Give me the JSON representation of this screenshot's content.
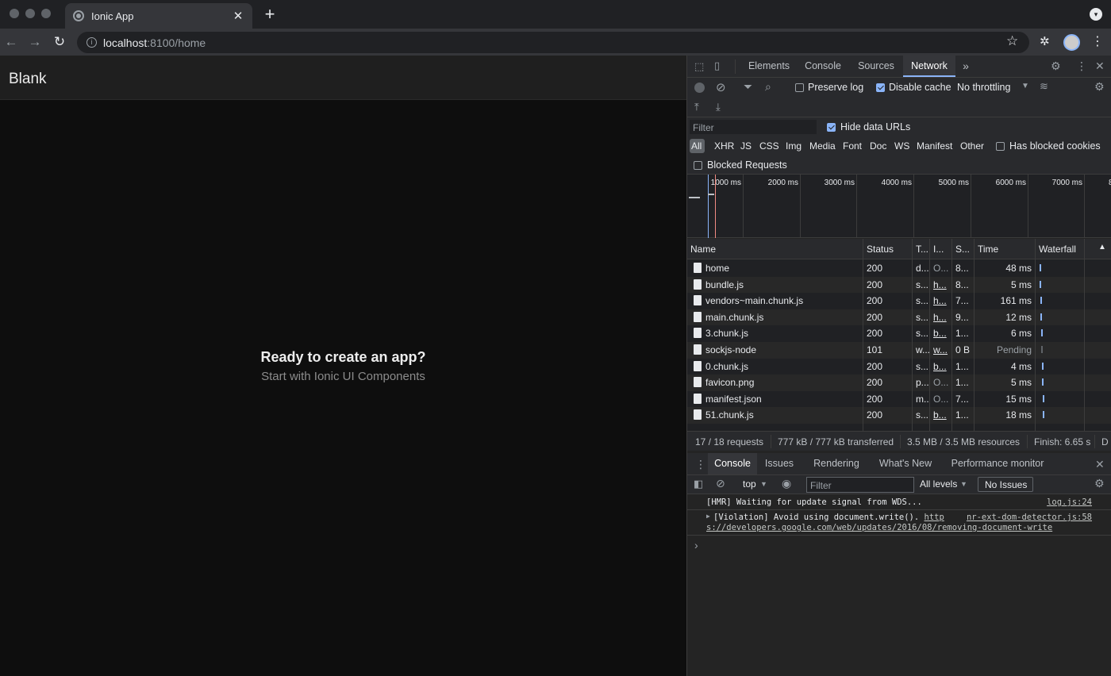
{
  "browser": {
    "tab_title": "Ionic App",
    "url_host": "localhost",
    "url_path": ":8100/home"
  },
  "app": {
    "title": "Blank",
    "empty_title": "Ready to create an app?",
    "empty_subtitle": "Start with Ionic UI Components"
  },
  "devtools": {
    "tabs": [
      "Elements",
      "Console",
      "Sources",
      "Network"
    ],
    "more_tabs": "»",
    "preserve_log": "Preserve log",
    "disable_cache": "Disable cache",
    "throttling": "No throttling",
    "filter_placeholder": "Filter",
    "hide_data_urls": "Hide data URLs",
    "types": [
      "All",
      "XHR",
      "JS",
      "CSS",
      "Img",
      "Media",
      "Font",
      "Doc",
      "WS",
      "Manifest",
      "Other"
    ],
    "has_blocked_cookies": "Has blocked cookies",
    "blocked_requests": "Blocked Requests",
    "timeline_ticks": [
      "1000 ms",
      "2000 ms",
      "3000 ms",
      "4000 ms",
      "5000 ms",
      "6000 ms",
      "7000 ms",
      "8"
    ],
    "columns": {
      "name": "Name",
      "status": "Status",
      "type": "T...",
      "initiator": "I...",
      "size": "S...",
      "time": "Time",
      "waterfall": "Waterfall"
    },
    "rows": [
      {
        "name": "home",
        "status": "200",
        "type": "d...",
        "initiator": "O...",
        "size": "8...",
        "time": "48 ms"
      },
      {
        "name": "bundle.js",
        "status": "200",
        "type": "s...",
        "initiator": "h...",
        "size": "8...",
        "time": "5 ms"
      },
      {
        "name": "vendors~main.chunk.js",
        "status": "200",
        "type": "s...",
        "initiator": "h...",
        "size": "7...",
        "time": "161 ms"
      },
      {
        "name": "main.chunk.js",
        "status": "200",
        "type": "s...",
        "initiator": "h...",
        "size": "9...",
        "time": "12 ms"
      },
      {
        "name": "3.chunk.js",
        "status": "200",
        "type": "s...",
        "initiator": "b...",
        "size": "1...",
        "time": "6 ms"
      },
      {
        "name": "sockjs-node",
        "status": "101",
        "type": "w...",
        "initiator": "w...",
        "size": "0 B",
        "time": "Pending"
      },
      {
        "name": "0.chunk.js",
        "status": "200",
        "type": "s...",
        "initiator": "b...",
        "size": "1...",
        "time": "4 ms"
      },
      {
        "name": "favicon.png",
        "status": "200",
        "type": "p...",
        "initiator": "O...",
        "size": "1...",
        "time": "5 ms"
      },
      {
        "name": "manifest.json",
        "status": "200",
        "type": "m...",
        "initiator": "O...",
        "size": "7...",
        "time": "15 ms"
      },
      {
        "name": "51.chunk.js",
        "status": "200",
        "type": "s...",
        "initiator": "b...",
        "size": "1...",
        "time": "18 ms"
      }
    ],
    "summary": {
      "requests": "17 / 18 requests",
      "transferred": "777 kB / 777 kB transferred",
      "resources": "3.5 MB / 3.5 MB resources",
      "finish": "Finish: 6.65 s",
      "dom": "D"
    },
    "drawer_tabs": [
      "Console",
      "Issues",
      "Rendering",
      "What's New",
      "Performance monitor"
    ],
    "console_context": "top",
    "console_filter_placeholder": "Filter",
    "log_levels": "All levels",
    "issues": "No Issues",
    "messages": [
      {
        "text": "[HMR] Waiting for update signal from WDS...",
        "source": "log.js:24"
      },
      {
        "text_prefix": "[Violation] Avoid using document.write(). ",
        "link_a": "http",
        "link_b": "s://developers.google.com/web/updates/2016/08/removing-document-write",
        "source": "nr-ext-dom-detector.js:58"
      }
    ],
    "prompt": "›"
  }
}
